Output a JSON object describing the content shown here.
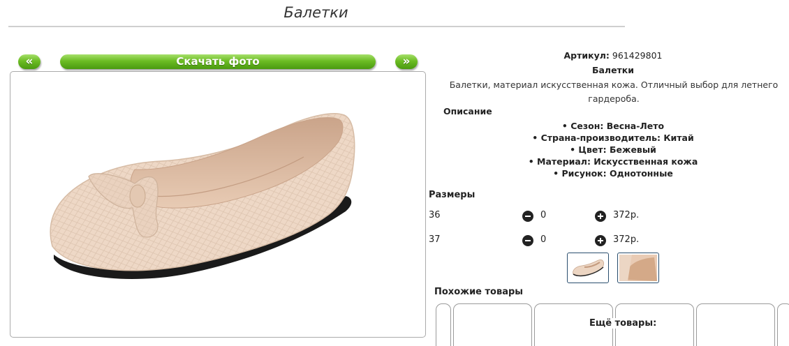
{
  "page": {
    "title": "Балетки"
  },
  "gallery": {
    "prev_label": "«",
    "download_label": "Скачать фото",
    "next_label": "»"
  },
  "product": {
    "article_label": "Артикул:",
    "article_value": "961429801",
    "name": "Балетки",
    "description": "Балетки, материал искусственная кожа. Отличный выбор для летнего гардероба.",
    "description_heading": "Описание",
    "features": [
      "Сезон: Весна-Лето",
      "Страна-производитель: Китай",
      "Цвет: Бежевый",
      "Материал: Искусственная кожа",
      "Рисунок: Однотонные"
    ]
  },
  "sizes": {
    "heading": "Размеры",
    "rows": [
      {
        "size": "36",
        "qty": "0",
        "price": "372р."
      },
      {
        "size": "37",
        "qty": "0",
        "price": "372р."
      }
    ]
  },
  "similar": {
    "heading": "Похожие товары",
    "more_label": "Ещё товары:"
  },
  "colors": {
    "button_green": "#6cbc24",
    "thumb_border": "#2a4e6e",
    "shoe": "#eed8c6"
  }
}
